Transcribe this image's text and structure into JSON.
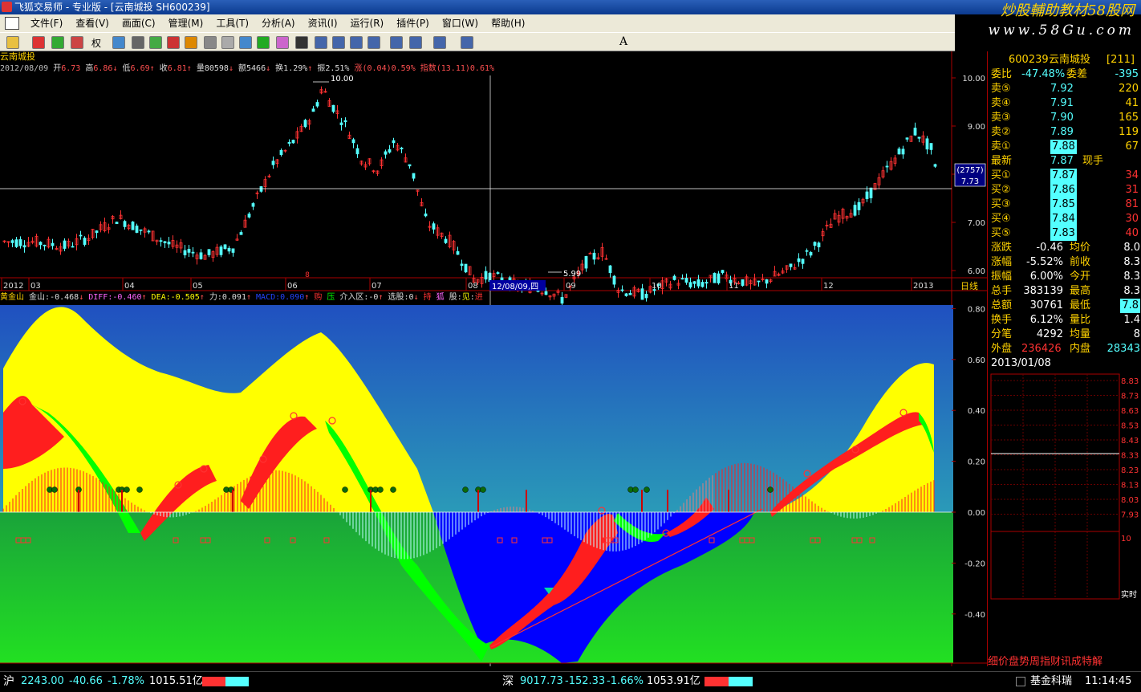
{
  "window": {
    "title": "飞狐交易师 - 专业版 - [云南城投 SH600239]"
  },
  "watermark": {
    "line1": "炒股輔助教材58股网",
    "line2": "www.58Gu.com"
  },
  "menu": [
    "文件(F)",
    "查看(V)",
    "画面(C)",
    "管理(M)",
    "工具(T)",
    "分析(A)",
    "资讯(I)",
    "运行(R)",
    "插件(P)",
    "窗口(W)",
    "帮助(H)"
  ],
  "toolbar": {
    "fuquan_label": "权",
    "text_tool": "A"
  },
  "kline": {
    "stock_name": "云南城投",
    "date": "2012/08/09",
    "open_label": "开",
    "open": "6.73",
    "high_label": "高",
    "high": "6.86",
    "low_label": "低",
    "low": "6.69",
    "close_label": "收",
    "close": "6.81",
    "volume_label": "量",
    "volume": "80598",
    "amount_label": "额",
    "amount": "5466",
    "turnover_label": "换",
    "turnover": "1.29%",
    "amplitude_label": "振",
    "amplitude": "2.51%",
    "change_label": "涨",
    "change": "(0.04)",
    "change_pct": "0.59%",
    "index_label": "指数",
    "index_value": "(13.11)",
    "index_pct": "0.61%",
    "price_ticks": [
      "10.00",
      "9.00",
      "8.00",
      "7.00",
      "6.00"
    ],
    "high_mark": "10.00",
    "low_mark": "5.99",
    "cursor_value_count": "(2757)",
    "cursor_value_price": "7.73",
    "x_labels": [
      "2012",
      "03",
      "04",
      "05",
      "06",
      "07",
      "08",
      "09",
      "10",
      "11",
      "12",
      "2013"
    ],
    "cursor_date": "12/08/09,四",
    "period": "日线",
    "event_mark": "8"
  },
  "indicator": {
    "name": "黄金山",
    "jinshan_label": "金山:",
    "jinshan": "-0.468",
    "diff_label": "DIFF:",
    "diff": "-0.460",
    "dea_label": "DEA:",
    "dea": "-0.505",
    "li_label": "力:",
    "li": "0.091",
    "macd_label": "MACD:",
    "macd": "0.090",
    "buy_label": "购",
    "press_label": "压",
    "jieru_label": "介入区:",
    "jieru": "-0",
    "xuangu_label": "选股:",
    "xuangu": "0",
    "chi_label": "持",
    "hu_label": "狐",
    "gu_label": "股:",
    "jian_label": "见",
    "jin_label": "进",
    "y_ticks": [
      "0.80",
      "0.60",
      "0.40",
      "0.20",
      "0.00",
      "-0.20",
      "-0.40"
    ]
  },
  "quote": {
    "code": "600239",
    "name": "云南城投",
    "number": "[211]",
    "weibi_label": "委比",
    "weibi": "-47.48%",
    "weicha_label": "委差",
    "weicha": "-395",
    "sells": [
      {
        "label": "卖⑤",
        "price": "7.92",
        "vol": "220"
      },
      {
        "label": "卖④",
        "price": "7.91",
        "vol": "41"
      },
      {
        "label": "卖③",
        "price": "7.90",
        "vol": "165"
      },
      {
        "label": "卖②",
        "price": "7.89",
        "vol": "119"
      },
      {
        "label": "卖①",
        "price": "7.88",
        "vol": "67"
      }
    ],
    "latest_label": "最新",
    "latest": "7.87",
    "xianshou_label": "现手",
    "buys": [
      {
        "label": "买①",
        "price": "7.87",
        "vol": "34"
      },
      {
        "label": "买②",
        "price": "7.86",
        "vol": "31"
      },
      {
        "label": "买③",
        "price": "7.85",
        "vol": "81"
      },
      {
        "label": "买④",
        "price": "7.84",
        "vol": "30"
      },
      {
        "label": "买⑤",
        "price": "7.83",
        "vol": "40"
      }
    ],
    "stats": [
      {
        "l1": "涨跌",
        "v1": "-0.46",
        "l2": "均价",
        "v2": "8.0"
      },
      {
        "l1": "涨幅",
        "v1": "-5.52%",
        "l2": "前收",
        "v2": "8.3"
      },
      {
        "l1": "振幅",
        "v1": "6.00%",
        "l2": "今开",
        "v2": "8.3"
      },
      {
        "l1": "总手",
        "v1": "383139",
        "l2": "最高",
        "v2": "8.3"
      },
      {
        "l1": "总额",
        "v1": "30761",
        "l2": "最低",
        "v2": "7.8"
      },
      {
        "l1": "换手",
        "v1": "6.12%",
        "l2": "量比",
        "v2": "1.4"
      },
      {
        "l1": "分笔",
        "v1": "4292",
        "l2": "均量",
        "v2": "8"
      }
    ],
    "waipan_label": "外盘",
    "waipan": "236426",
    "neipan_label": "内盘",
    "neipan": "28343",
    "minute_date": "2013/01/08",
    "minute_ticks": [
      "8.83",
      "8.73",
      "8.63",
      "8.53",
      "8.43",
      "8.33",
      "8.23",
      "8.13",
      "8.03",
      "7.93"
    ],
    "vol_tick": "10",
    "realtime_label": "实时",
    "tabs": "细价盘势周指财讯成特解"
  },
  "status": {
    "sh_label": "沪",
    "sh_index": "2243.00",
    "sh_change": "-40.66",
    "sh_pct": "-1.78%",
    "sh_amount": "1015.51亿",
    "sz_label": "深",
    "sz_index": "9017.73",
    "sz_change": "-152.33",
    "sz_pct": "-1.66%",
    "sz_amount": "1053.91亿",
    "ticker": "基金科瑞",
    "time": "11:14:45"
  },
  "colors": {
    "up": "#ff3232",
    "down": "#54ffff",
    "yellow": "#ffff00",
    "green": "#00ff00",
    "blue": "#0000ff",
    "bg": "#000000"
  }
}
